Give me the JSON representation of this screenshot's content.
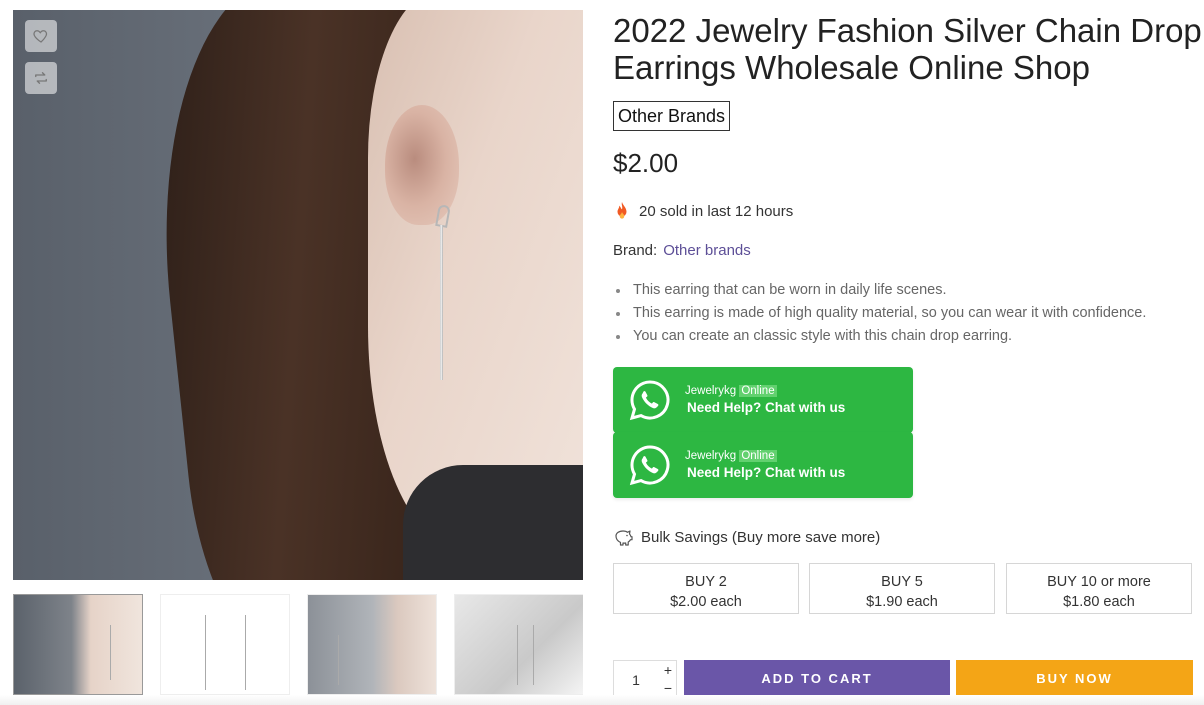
{
  "product": {
    "title": "2022 Jewelry Fashion Silver Chain Drop Earrings Wholesale Online Shop",
    "brand_tag": "Other Brands",
    "price": "$2.00",
    "sold_text": "20 sold in last 12 hours",
    "brand_label": "Brand:",
    "brand_value": "Other brands",
    "features": [
      "This earring that can be worn in daily life scenes.",
      "This earring is made of high quality material, so you can wear it with confidence.",
      "You can create an classic style with this chain drop earring."
    ]
  },
  "whatsapp": [
    {
      "name": "Jewelrykg",
      "status": "Online",
      "cta": "Need Help? Chat with us"
    },
    {
      "name": "Jewelrykg",
      "status": "Online",
      "cta": "Need Help? Chat with us"
    }
  ],
  "bulk": {
    "heading": "Bulk Savings (Buy more save more)",
    "tiers": [
      {
        "qty": "BUY 2",
        "price": "$2.00 each"
      },
      {
        "qty": "BUY 5",
        "price": "$1.90 each"
      },
      {
        "qty": "BUY 10 or more",
        "price": "$1.80 each"
      }
    ]
  },
  "purchase": {
    "quantity": "1",
    "plus": "+",
    "minus": "−",
    "add_to_cart": "ADD TO CART",
    "buy_now": "BUY NOW"
  },
  "colors": {
    "whatsapp_green": "#2db742",
    "cart_purple": "#6a56a8",
    "buy_orange": "#f4a516",
    "brand_link": "#5d4f97"
  },
  "icons": [
    "heart-icon",
    "compare-icon",
    "fire-icon",
    "whatsapp-icon",
    "piggy-bank-icon"
  ]
}
